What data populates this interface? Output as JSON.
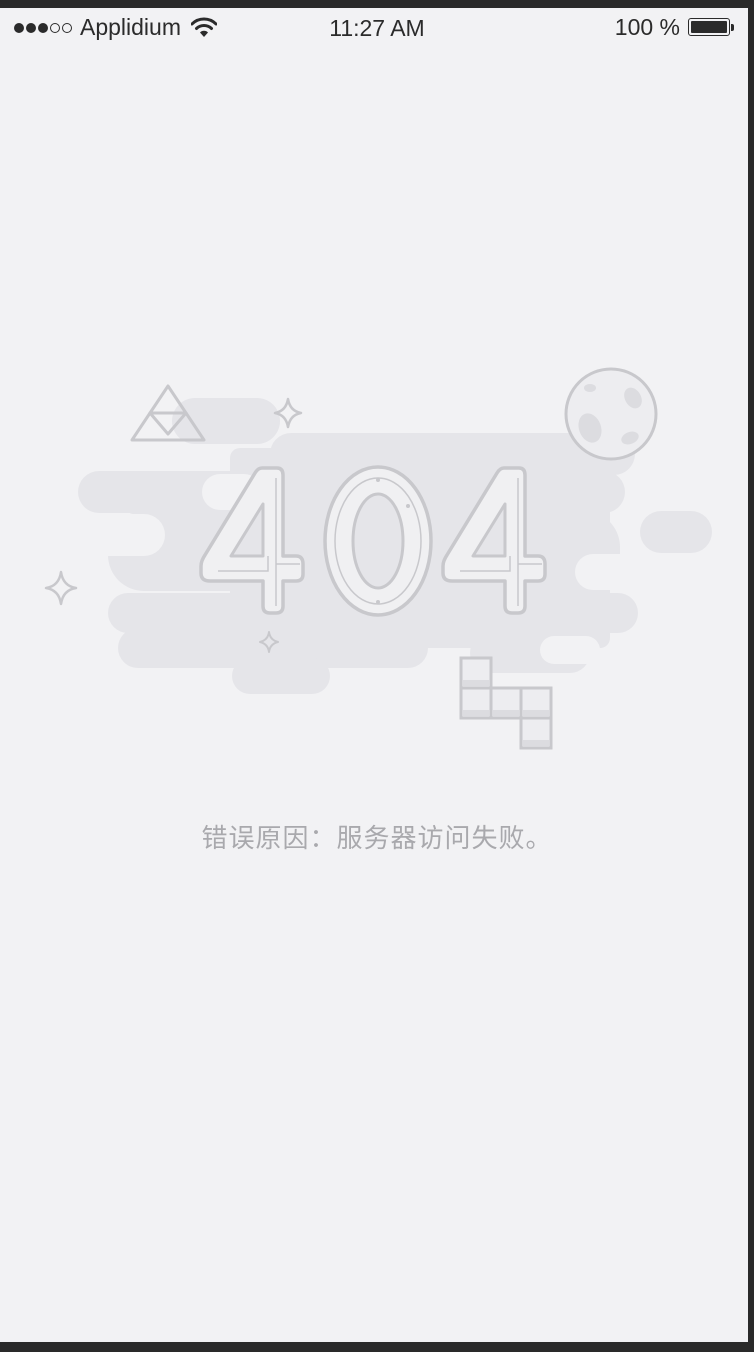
{
  "status_bar": {
    "carrier": "Applidium",
    "time": "11:27 AM",
    "battery": "100 %",
    "signal_bars_filled": 3,
    "signal_bars_total": 5
  },
  "illustration": {
    "code": "404"
  },
  "error_message": "错误原因：服务器访问失败。",
  "colors": {
    "background": "#f2f2f4",
    "cloud": "#e5e5e9",
    "line": "#c8c8cc",
    "text": "#a9a9ad"
  }
}
